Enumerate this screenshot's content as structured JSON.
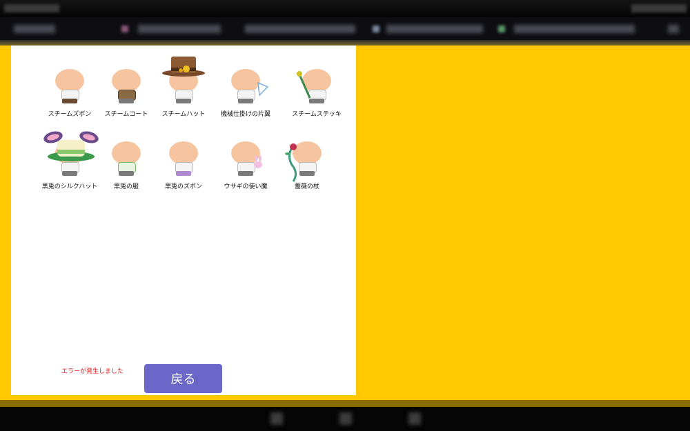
{
  "items_row1": [
    {
      "label": "スチームズボン",
      "icon": "steam-pants-icon"
    },
    {
      "label": "スチームコート",
      "icon": "steam-coat-icon"
    },
    {
      "label": "スチームハット",
      "icon": "steam-hat-icon"
    },
    {
      "label": "機械仕掛けの片翼",
      "icon": "mechanical-wing-icon"
    },
    {
      "label": "スチームステッキ",
      "icon": "steam-stick-icon"
    }
  ],
  "items_row2": [
    {
      "label": "黒兎のシルクハット",
      "icon": "bunny-silk-hat-icon"
    },
    {
      "label": "黒兎の服",
      "icon": "bunny-clothes-icon"
    },
    {
      "label": "黒兎のズボン",
      "icon": "bunny-pants-icon"
    },
    {
      "label": "ウサギの使い魔",
      "icon": "rabbit-familiar-icon"
    },
    {
      "label": "薔薇の杖",
      "icon": "rose-staff-icon"
    }
  ],
  "footer": {
    "error_message": "エラーが発生しました",
    "back_label": "戻る"
  },
  "colors": {
    "stage_background": "#ffc800",
    "button": "#6a67c9",
    "error": "#e02020"
  }
}
